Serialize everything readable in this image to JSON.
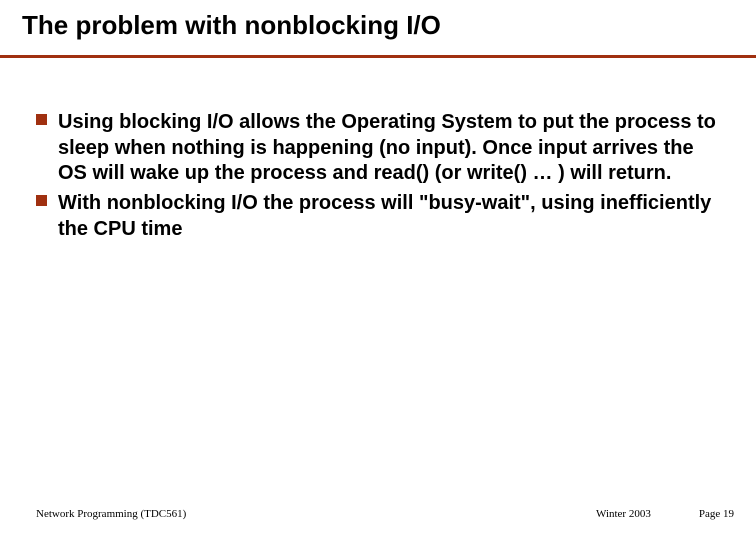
{
  "slide": {
    "title": "The problem with nonblocking I/O",
    "bullets": [
      "Using blocking I/O allows the Operating System to put the process to sleep when nothing is happening (no input). Once input arrives the OS will wake up the process and read() (or write() … ) will return.",
      "With nonblocking I/O the process will \"busy-wait\", using inefficiently the CPU time"
    ]
  },
  "footer": {
    "left": "Network Programming (TDC561)",
    "center": "Winter 2003",
    "right": "Page 19"
  }
}
